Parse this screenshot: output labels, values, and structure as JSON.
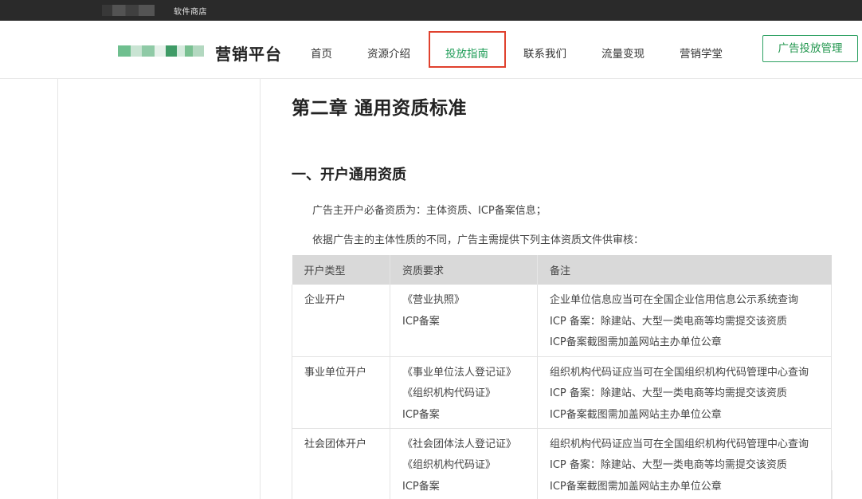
{
  "topbar": {
    "label": "软件商店"
  },
  "header": {
    "brand": "营销平台",
    "nav": [
      "首页",
      "资源介绍",
      "投放指南",
      "联系我们",
      "流量变现",
      "营销学堂"
    ],
    "active_nav": "投放指南",
    "cta": "广告投放管理"
  },
  "content": {
    "chapter_title": "第二章 通用资质标准",
    "section_title": "一、开户通用资质",
    "para1": "广告主开户必备资质为：主体资质、ICP备案信息；",
    "para2": "依据广告主的主体性质的不同，广告主需提供下列主体资质文件供审核：",
    "table": {
      "headers": [
        "开户类型",
        "资质要求",
        "备注"
      ],
      "rows": [
        {
          "type": "企业开户",
          "reqs": [
            "《营业执照》",
            "ICP备案"
          ],
          "notes": [
            "企业单位信息应当可在全国企业信用信息公示系统查询",
            "ICP 备案：除建站、大型一类电商等均需提交该资质",
            "ICP备案截图需加盖网站主办单位公章"
          ]
        },
        {
          "type": "事业单位开户",
          "reqs": [
            "《事业单位法人登记证》",
            "《组织机构代码证》",
            "ICP备案"
          ],
          "notes": [
            "组织机构代码证应当可在全国组织机构代码管理中心查询",
            "ICP 备案：除建站、大型一类电商等均需提交该资质",
            "ICP备案截图需加盖网站主办单位公章"
          ]
        },
        {
          "type": "社会团体开户",
          "reqs": [
            "《社会团体法人登记证》",
            "《组织机构代码证》",
            "ICP备案"
          ],
          "notes": [
            "组织机构代码证应当可在全国组织机构代码管理中心查询",
            "ICP 备案：除建站、大型一类电商等均需提交该资质",
            "ICP备案截图需加盖网站主办单位公章"
          ]
        }
      ]
    }
  },
  "colors": {
    "accent": "#1e9c57",
    "highlight": "#e0412e",
    "topbar": "#2a2a2a",
    "table_header": "#d9d9d9"
  }
}
